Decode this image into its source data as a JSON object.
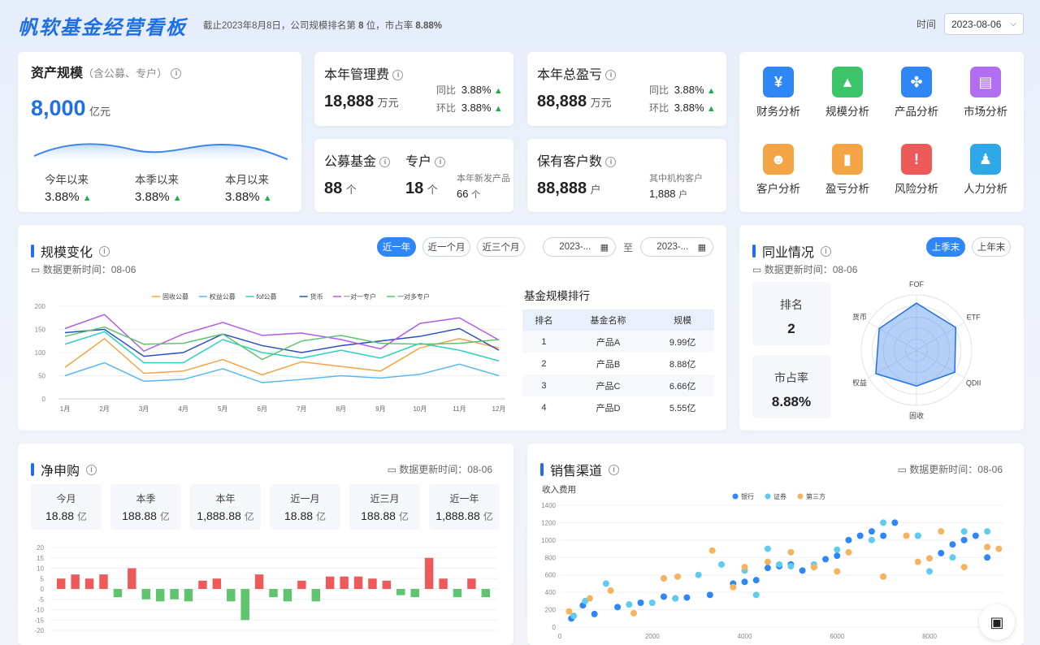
{
  "header": {
    "brand": "帆软基金经营看板",
    "subtitle_prefix": "截止2023年8月8日，公司规模排名第",
    "subtitle_rank": "8",
    "subtitle_mid": "位，市占率",
    "subtitle_share": "8.88%",
    "time_label": "时间",
    "date": "2023-08-06"
  },
  "asset": {
    "title": "资产规模",
    "subtitle": "（含公募、专户）",
    "value": "8,000",
    "unit": "亿元",
    "stats": [
      {
        "label": "今年以来",
        "value": "3.88%"
      },
      {
        "label": "本季以来",
        "value": "3.88%"
      },
      {
        "label": "本月以来",
        "value": "3.88%"
      }
    ]
  },
  "mgmt": {
    "title": "本年管理费",
    "value": "18,888",
    "unit": "万元",
    "yoy_label": "同比",
    "yoy": "3.88%",
    "mom_label": "环比",
    "mom": "3.88%"
  },
  "pnl": {
    "title": "本年总盈亏",
    "value": "88,888",
    "unit": "万元",
    "yoy_label": "同比",
    "yoy": "3.88%",
    "mom_label": "环比",
    "mom": "3.88%"
  },
  "fund": {
    "public_title": "公募基金",
    "public_value": "88",
    "public_unit": "个",
    "special_title": "专户",
    "special_value": "18",
    "special_unit": "个",
    "new_label": "本年新发产品",
    "new_value": "66",
    "new_unit": "个"
  },
  "clients": {
    "title": "保有客户数",
    "value": "88,888",
    "unit": "户",
    "inst_label": "其中机构客户",
    "inst_value": "1,888",
    "inst_unit": "户"
  },
  "shortcuts": [
    {
      "label": "财务分析",
      "icon": "finance-icon",
      "color": "#2f86f6",
      "glyph": "¥"
    },
    {
      "label": "规模分析",
      "icon": "scale-chart-icon",
      "color": "#3cc46a",
      "glyph": "▲"
    },
    {
      "label": "产品分析",
      "icon": "product-icon",
      "color": "#2f86f6",
      "glyph": "✤"
    },
    {
      "label": "市场分析",
      "icon": "market-icon",
      "color": "#b26ef0",
      "glyph": "▤"
    },
    {
      "label": "客户分析",
      "icon": "client-icon",
      "color": "#f5a445",
      "glyph": "☻"
    },
    {
      "label": "盈亏分析",
      "icon": "candlestick-icon",
      "color": "#f5a445",
      "glyph": "▮"
    },
    {
      "label": "风险分析",
      "icon": "risk-icon",
      "color": "#ee5a5a",
      "glyph": "!"
    },
    {
      "label": "人力分析",
      "icon": "hr-icon",
      "color": "#2fa8e8",
      "glyph": "♟"
    }
  ],
  "scale": {
    "title": "规模变化",
    "updated": "数据更新时间：08-06",
    "tabs": [
      "近一年",
      "近一个月",
      "近三个月"
    ],
    "date_from": "2023-...",
    "date_to": "2023-...",
    "to_label": "至"
  },
  "ranking": {
    "title": "基金规模排行",
    "headers": [
      "排名",
      "基金名称",
      "规模"
    ],
    "rows": [
      {
        "rank": "1",
        "name": "产品A",
        "size": "9.99亿"
      },
      {
        "rank": "2",
        "name": "产品B",
        "size": "8.88亿"
      },
      {
        "rank": "3",
        "name": "产品C",
        "size": "6.66亿"
      },
      {
        "rank": "4",
        "name": "产品D",
        "size": "5.55亿"
      }
    ]
  },
  "peer": {
    "title": "同业情况",
    "updated": "数据更新时间：08-06",
    "tabs": [
      "上季末",
      "上年末"
    ],
    "rank_label": "排名",
    "rank_value": "2",
    "share_label": "市占率",
    "share_value": "8.88%"
  },
  "netbuy": {
    "title": "净申购",
    "updated": "数据更新时间：08-06",
    "periods": [
      {
        "label": "今月",
        "value": "18.88",
        "unit": "亿"
      },
      {
        "label": "本季",
        "value": "188.88",
        "unit": "亿"
      },
      {
        "label": "本年",
        "value": "1,888.88",
        "unit": "亿"
      },
      {
        "label": "近一月",
        "value": "18.88",
        "unit": "亿"
      },
      {
        "label": "近三月",
        "value": "188.88",
        "unit": "亿"
      },
      {
        "label": "近一年",
        "value": "1,888.88",
        "unit": "亿"
      }
    ]
  },
  "sales": {
    "title": "销售渠道",
    "updated": "数据更新时间：08-06"
  },
  "chart_data": [
    {
      "type": "line",
      "id": "scale-line",
      "categories": [
        "1月",
        "2月",
        "3月",
        "4月",
        "5月",
        "6月",
        "7月",
        "8月",
        "9月",
        "10月",
        "11月",
        "12月"
      ],
      "ylim": [
        0,
        200
      ],
      "yticks": [
        0,
        50,
        100,
        150,
        200
      ],
      "legend": "top",
      "series": [
        {
          "name": "固收公募",
          "color": "#f5a445",
          "values": [
            68,
            130,
            55,
            60,
            85,
            52,
            80,
            70,
            60,
            110,
            130,
            110
          ]
        },
        {
          "name": "权益公募",
          "color": "#5ab8f0",
          "values": [
            50,
            78,
            38,
            42,
            65,
            35,
            42,
            50,
            45,
            53,
            75,
            50
          ]
        },
        {
          "name": "fof公募",
          "color": "#2ecfc0",
          "values": [
            118,
            145,
            78,
            78,
            128,
            100,
            88,
            105,
            88,
            120,
            105,
            82
          ]
        },
        {
          "name": "货币",
          "color": "#2a4fc4",
          "values": [
            143,
            150,
            92,
            100,
            140,
            115,
            100,
            115,
            125,
            135,
            152,
            105
          ]
        },
        {
          "name": "一对一专户",
          "color": "#b25ce6",
          "values": [
            152,
            182,
            103,
            140,
            165,
            137,
            142,
            128,
            108,
            163,
            175,
            127
          ]
        },
        {
          "name": "一对多专户",
          "color": "#5fc46e",
          "values": [
            135,
            155,
            118,
            120,
            140,
            85,
            125,
            137,
            120,
            118,
            120,
            128
          ]
        }
      ]
    },
    {
      "type": "radar",
      "id": "peer-radar",
      "axes": [
        "FOF",
        "ETF",
        "QDII",
        "固收",
        "权益",
        "货币"
      ],
      "max": 100,
      "values": [
        85,
        82,
        80,
        65,
        85,
        78
      ]
    },
    {
      "type": "bar",
      "id": "netbuy-bar",
      "ylim": [
        -20,
        20
      ],
      "yticks": [
        20,
        15,
        10,
        5,
        0,
        -5,
        -10,
        -15,
        -20
      ],
      "values": [
        5,
        7,
        5,
        7,
        -4,
        10,
        -5,
        -6,
        -5,
        -6,
        4,
        5,
        -6,
        -15,
        7,
        -4,
        -6,
        4,
        -6,
        6,
        6,
        6,
        5,
        4,
        -3,
        -4,
        15,
        5,
        -4,
        5,
        -4
      ]
    },
    {
      "type": "scatter",
      "id": "sales-scatter",
      "ylabel": "收入费用",
      "xlim": [
        0,
        9600
      ],
      "ylim": [
        0,
        1400
      ],
      "xticks": [
        0,
        2000,
        4000,
        6000,
        8000
      ],
      "yticks": [
        0,
        200,
        400,
        600,
        800,
        1000,
        1200,
        1400
      ],
      "series": [
        {
          "name": "银行",
          "color": "#2f86f6",
          "points": [
            [
              250,
              100
            ],
            [
              500,
              250
            ],
            [
              750,
              150
            ],
            [
              1250,
              230
            ],
            [
              1750,
              280
            ],
            [
              2250,
              350
            ],
            [
              2500,
              330
            ],
            [
              2750,
              340
            ],
            [
              3250,
              370
            ],
            [
              3750,
              500
            ],
            [
              4000,
              520
            ],
            [
              4250,
              540
            ],
            [
              4500,
              680
            ],
            [
              4750,
              700
            ],
            [
              5000,
              720
            ],
            [
              5250,
              650
            ],
            [
              5500,
              690
            ],
            [
              5750,
              780
            ],
            [
              6000,
              820
            ],
            [
              6250,
              1000
            ],
            [
              6500,
              1050
            ],
            [
              6750,
              1100
            ],
            [
              7000,
              1050
            ],
            [
              7250,
              1200
            ],
            [
              7750,
              1050
            ],
            [
              8250,
              850
            ],
            [
              8500,
              950
            ],
            [
              8750,
              1000
            ],
            [
              9000,
              1050
            ],
            [
              9250,
              800
            ]
          ]
        },
        {
          "name": "证券",
          "color": "#5ecbf0",
          "points": [
            [
              300,
              130
            ],
            [
              550,
              300
            ],
            [
              1000,
              500
            ],
            [
              1500,
              260
            ],
            [
              2000,
              280
            ],
            [
              2500,
              330
            ],
            [
              3000,
              600
            ],
            [
              3500,
              720
            ],
            [
              4000,
              650
            ],
            [
              4250,
              370
            ],
            [
              4500,
              900
            ],
            [
              4750,
              720
            ],
            [
              5000,
              700
            ],
            [
              5500,
              720
            ],
            [
              6000,
              890
            ],
            [
              6750,
              1000
            ],
            [
              7000,
              1200
            ],
            [
              7750,
              1050
            ],
            [
              8000,
              640
            ],
            [
              8500,
              800
            ],
            [
              8750,
              1100
            ],
            [
              9250,
              1100
            ]
          ]
        },
        {
          "name": "第三方",
          "color": "#f5b35e",
          "points": [
            [
              200,
              180
            ],
            [
              650,
              330
            ],
            [
              1100,
              420
            ],
            [
              1600,
              160
            ],
            [
              2250,
              560
            ],
            [
              2550,
              580
            ],
            [
              3300,
              880
            ],
            [
              3750,
              460
            ],
            [
              4000,
              690
            ],
            [
              4500,
              750
            ],
            [
              5000,
              860
            ],
            [
              5500,
              690
            ],
            [
              6000,
              640
            ],
            [
              6250,
              860
            ],
            [
              7000,
              580
            ],
            [
              7500,
              1050
            ],
            [
              7750,
              750
            ],
            [
              8000,
              790
            ],
            [
              8250,
              1100
            ],
            [
              8750,
              690
            ],
            [
              9250,
              920
            ],
            [
              9500,
              900
            ]
          ]
        }
      ]
    }
  ]
}
